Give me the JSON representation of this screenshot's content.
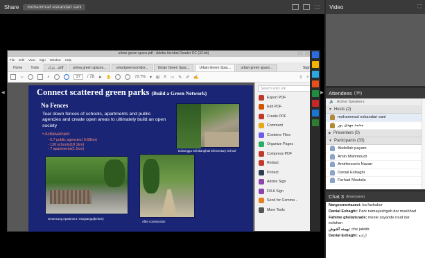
{
  "share": {
    "title": "Share",
    "presenter": "mohammad eskandari sani",
    "acrobat": {
      "window_title": "urban green space.pdf - Adobe Acrobat Reader DC (32-bit)",
      "menu": [
        "File",
        "Edit",
        "View",
        "Sign",
        "Window",
        "Help"
      ],
      "tabs": [
        {
          "label": "Home",
          "kind": "home"
        },
        {
          "label": "Tools",
          "kind": "home"
        },
        {
          "label": "پارک ...pdf",
          "kind": "tab"
        },
        {
          "label": "prima green spaces...",
          "kind": "tab"
        },
        {
          "label": "smartgreencorridor...",
          "kind": "tab"
        },
        {
          "label": "Urban Green Spac...",
          "kind": "tab"
        },
        {
          "label": "Urban Green Spac...",
          "kind": "active"
        },
        {
          "label": "urban green space...",
          "kind": "tab"
        }
      ],
      "sign_in": "Sign In",
      "page_current": "37",
      "page_total": "/ 78",
      "zoom": "72.7%",
      "slide": {
        "title": "Connect scattered green parks",
        "title_suffix": "(Build a Green Network)",
        "subtitle": "No Fences",
        "body": "Tear down fences of schools, apartments and public agencies and create open areas to ultimately build an open society",
        "achievement_label": "Achievement",
        "achievements": [
          "- 6.7 public agencies( 9.68km)",
          "- 130 schools(18.1km)",
          "- 7 apartments(1.1km)"
        ],
        "captions": [
          "Dobonggu Shinbanghak Elementary School",
          "Geumcung Apartment, Yongsangu(before)",
          "After construction"
        ]
      },
      "tools_search": "Search and Link",
      "tools": [
        {
          "label": "Export PDF",
          "color": "#c0392b",
          "chevron": true
        },
        {
          "label": "Edit PDF",
          "color": "#d35400",
          "chevron": false
        },
        {
          "label": "Create PDF",
          "color": "#c0392b",
          "chevron": true
        },
        {
          "label": "Comment",
          "color": "#e6a817",
          "chevron": false
        },
        {
          "label": "Combine Files",
          "color": "#6c5ce7",
          "chevron": false
        },
        {
          "label": "Organize Pages",
          "color": "#27ae60",
          "chevron": false
        },
        {
          "label": "Compress PDF",
          "color": "#c0392b",
          "chevron": false
        },
        {
          "label": "Redact",
          "color": "#c0392b",
          "chevron": false
        },
        {
          "label": "Protect",
          "color": "#2c3e50",
          "chevron": false
        },
        {
          "label": "Adobe Sign",
          "color": "#8e44ad",
          "chevron": false
        },
        {
          "label": "Fill & Sign",
          "color": "#8e44ad",
          "chevron": false
        },
        {
          "label": "Send for Comme...",
          "color": "#e67e22",
          "chevron": false
        },
        {
          "label": "More Tools",
          "color": "#555555",
          "chevron": false
        }
      ]
    }
  },
  "video": {
    "title": "Video"
  },
  "attendees": {
    "title": "Attendees",
    "count": "(36)",
    "active_speakers": "Active Speakers",
    "hosts_label": "Hosts (2)",
    "hosts": [
      "mohammad eskandari sani",
      "محمد مهدی پور"
    ],
    "presenters_label": "Presenters (0)",
    "participants_label": "Participants (33)",
    "participants": [
      "Abdollah payam",
      "Amin Mahmoudi",
      "Amirhossein Nazari",
      "Danial Eshaghi",
      "Farhad Mostafa"
    ]
  },
  "chat": {
    "title": "Chat 3",
    "scope": "(Everyone)",
    "messages": [
      {
        "who": "Nargesmortazavi:",
        "text": " ba fashakor"
      },
      {
        "who": "Danial Eshaghi:",
        "text": " Park namayeshgah dar mashhad"
      },
      {
        "who": "Fahime gholamzade:",
        "text": " mesle zayande roud dar esfahan"
      },
      {
        "who": "بهمنه آشوش:",
        "text": " che jalebb"
      },
      {
        "who": "Danial Eshaghi:",
        "text": " اراده"
      }
    ]
  },
  "colors": {
    "slide_bg": "#1a2675",
    "achievement": "#ff8a7a",
    "pod_header": "#3a3a3a"
  }
}
